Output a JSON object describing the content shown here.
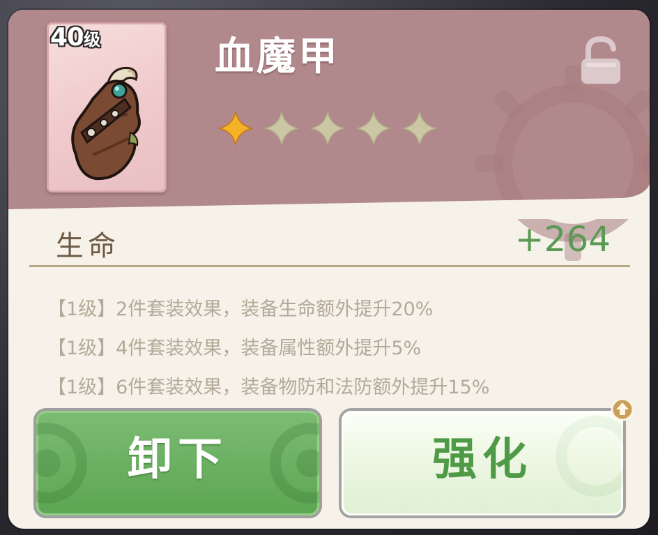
{
  "item": {
    "level_number": "40",
    "level_unit": "级",
    "name": "血魔甲",
    "stars_total": 5,
    "stars_filled": 1,
    "locked": false
  },
  "stat": {
    "label": "生命",
    "value": "+264"
  },
  "set_effects": [
    "【1级】2件套装效果，装备生命额外提升20%",
    "【1级】4件套装效果，装备属性额外提升5%",
    "【1级】6件套装效果，装备物防和法防额外提升15%"
  ],
  "buttons": {
    "unequip_label": "卸下",
    "enhance_label": "强化"
  },
  "icons": {
    "lock": "unlocked-padlock-icon",
    "star_filled": "gold-star-icon",
    "star_empty": "grey-star-icon",
    "upgrade": "upgrade-arrow-icon"
  },
  "colors": {
    "header": "#b1888b",
    "panel": "#f6f2ea",
    "stat_value": "#5a9a55",
    "unequip_button": "#6bb062",
    "enhance_text": "#4f9a47",
    "star_gold": "#f4b227",
    "star_grey": "#cbc6a3"
  }
}
